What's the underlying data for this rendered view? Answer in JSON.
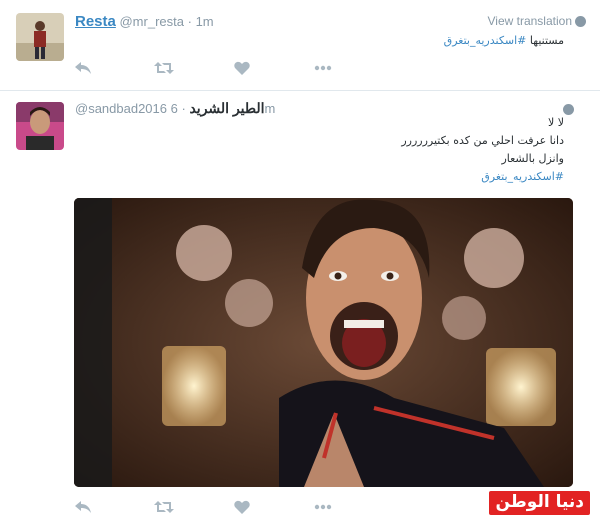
{
  "tweet1": {
    "display_name": "Resta",
    "handle": "@mr_resta",
    "separator": "·",
    "time": "1m",
    "view_translation": "View translation",
    "text": "مستنيها",
    "hashtag": "#اسكندريه_بتغرق"
  },
  "tweet2": {
    "display_name": "الطير الشريد",
    "handle": "@sandbad2016",
    "separator": "·",
    "time": "6m",
    "line1": "لا لا",
    "line2": "دانا عرفت احلي من كده بكتيرررررر",
    "line3": "وانزل بالشعار",
    "hashtag": "#اسكندريه_بتغرق"
  },
  "actions": [
    "reply-icon",
    "retweet-icon",
    "like-icon",
    "more-icon"
  ],
  "watermark": "دنيا الوطن",
  "colors": {
    "link": "#3b88c3",
    "muted": "#8899a6",
    "action": "#aab8c2",
    "watermark_bg": "#e22323"
  }
}
